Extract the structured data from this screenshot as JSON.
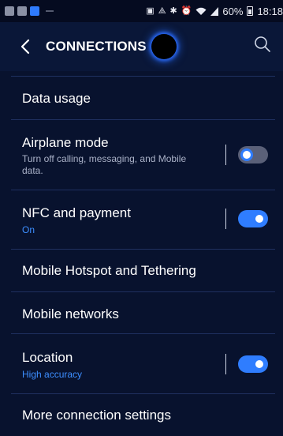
{
  "status_bar": {
    "battery": "60%",
    "time": "18:18",
    "icons": [
      "screenshot-icon",
      "share-icon",
      "bluetooth-icon",
      "alarm-icon",
      "wifi-icon",
      "signal-icon",
      "battery-icon"
    ]
  },
  "header": {
    "title": "CONNECTIONS",
    "back_icon": "chevron-left-icon",
    "search_icon": "search-icon"
  },
  "settings": [
    {
      "title": "Data usage"
    },
    {
      "title": "Airplane mode",
      "subtitle": "Turn off calling, messaging, and Mobile data.",
      "toggle": false
    },
    {
      "title": "NFC and payment",
      "subtitle": "On",
      "toggle": true
    },
    {
      "title": "Mobile Hotspot and Tethering"
    },
    {
      "title": "Mobile networks"
    },
    {
      "title": "Location",
      "subtitle": "High accuracy",
      "toggle": true
    },
    {
      "title": "More connection settings"
    }
  ],
  "colors": {
    "background": "#08122e",
    "accent": "#2f7dff",
    "divider": "#1f3060"
  }
}
